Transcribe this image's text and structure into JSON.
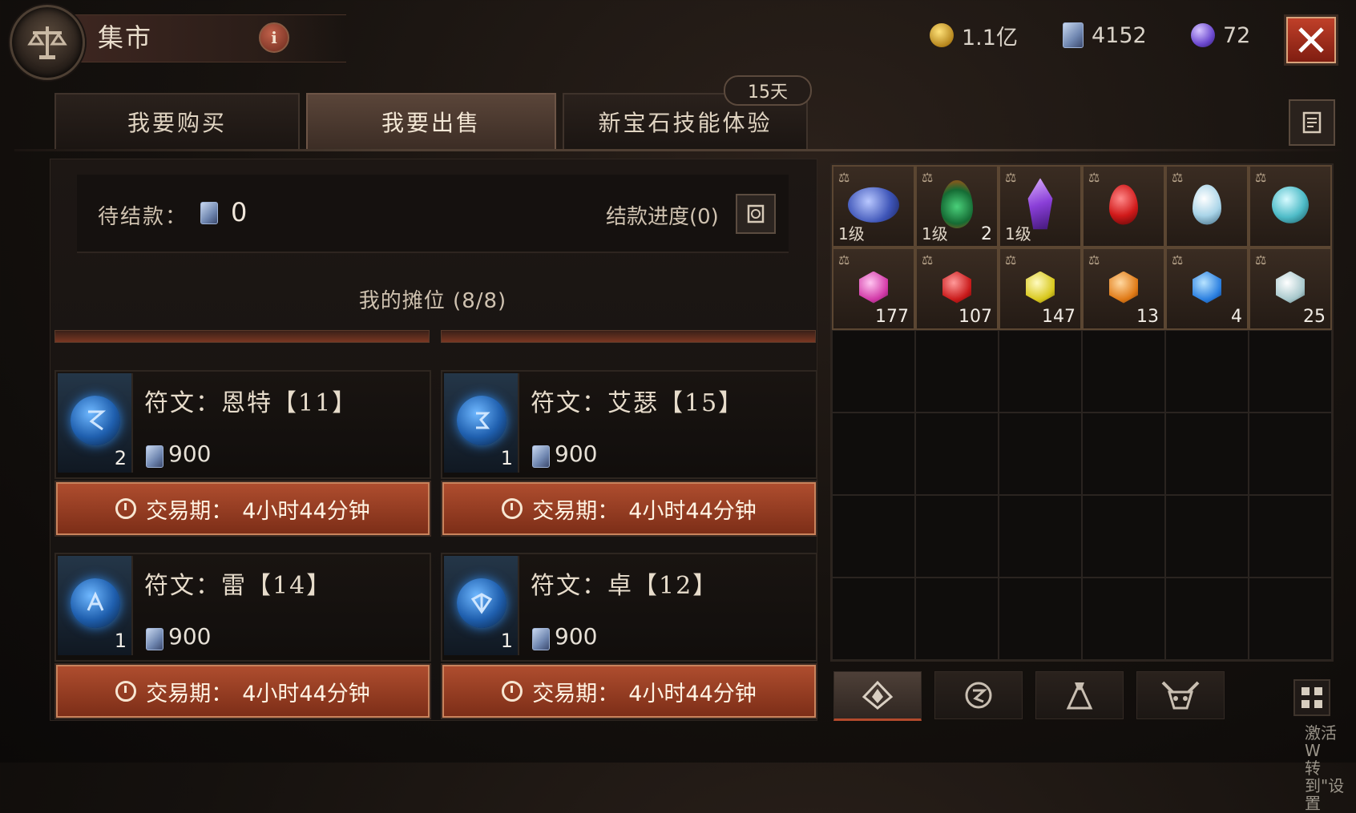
{
  "header": {
    "title": "集市",
    "info_label": "i",
    "currencies": [
      {
        "name": "gold",
        "icon": "gold-coin-icon",
        "value": "1.1亿"
      },
      {
        "name": "gem-card",
        "icon": "gem-card-icon",
        "value": "4152"
      },
      {
        "name": "orb",
        "icon": "purple-orb-icon",
        "value": "72"
      }
    ]
  },
  "tabs": [
    {
      "label": "我要购买",
      "active": false
    },
    {
      "label": "我要出售",
      "active": true
    },
    {
      "label": "新宝石技能体验",
      "active": false
    }
  ],
  "duration_badge": "15天",
  "pending": {
    "label": "待结款：",
    "value": "0",
    "progress_label": "结款进度(0)"
  },
  "stall_title": "我的摊位 (8/8)",
  "listings": [
    {
      "name": "符文：恩特【11】",
      "count": "2",
      "price": "900",
      "trade_label": "交易期：",
      "trade_time": "4小时44分钟"
    },
    {
      "name": "符文：艾瑟【15】",
      "count": "1",
      "price": "900",
      "trade_label": "交易期：",
      "trade_time": "4小时44分钟"
    },
    {
      "name": "符文：雷【14】",
      "count": "1",
      "price": "900",
      "trade_label": "交易期：",
      "trade_time": "4小时44分钟"
    },
    {
      "name": "符文：卓【12】",
      "count": "1",
      "price": "900",
      "trade_label": "交易期：",
      "trade_time": "4小时44分钟"
    }
  ],
  "inventory": [
    {
      "kind": "blue-relic",
      "level": "1级",
      "qty": ""
    },
    {
      "kind": "green-crest",
      "level": "1级",
      "qty": "2"
    },
    {
      "kind": "purple-crystal",
      "level": "1级",
      "qty": ""
    },
    {
      "kind": "red-drop",
      "level": "",
      "qty": ""
    },
    {
      "kind": "clear-drop",
      "level": "",
      "qty": ""
    },
    {
      "kind": "teal-orb",
      "level": "",
      "qty": ""
    },
    {
      "kind": "amethyst",
      "level": "",
      "qty": "177"
    },
    {
      "kind": "ruby",
      "level": "",
      "qty": "107"
    },
    {
      "kind": "topaz",
      "level": "",
      "qty": "147"
    },
    {
      "kind": "amber",
      "level": "",
      "qty": "13"
    },
    {
      "kind": "sapphire",
      "level": "",
      "qty": "4"
    },
    {
      "kind": "diamond",
      "level": "",
      "qty": "25"
    }
  ],
  "inventory_tabs": [
    "gem-tab-icon",
    "rune-tab-icon",
    "bag-tab-icon",
    "demon-tab-icon"
  ],
  "watermark": {
    "line1": "激活 W",
    "line2": "转到\"设置"
  },
  "colors": {
    "accent": "#b04e2f",
    "rune_blue": "#2f7fd8"
  }
}
